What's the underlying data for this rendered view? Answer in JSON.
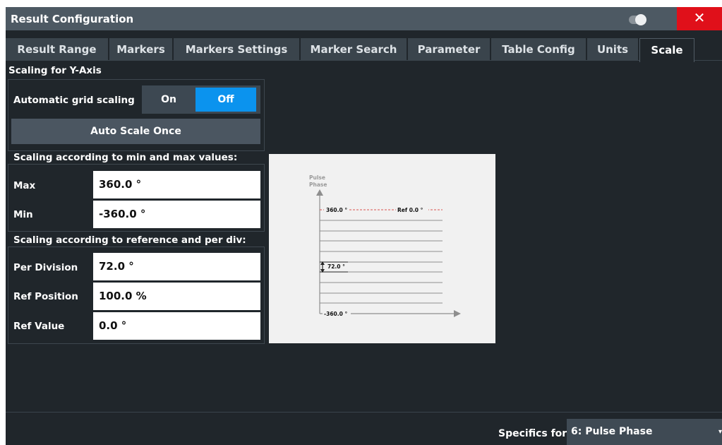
{
  "window": {
    "title": "Result Configuration"
  },
  "tabs": [
    {
      "label": "Result Range"
    },
    {
      "label": "Markers"
    },
    {
      "label": "Markers Settings"
    },
    {
      "label": "Marker Search"
    },
    {
      "label": "Parameter"
    },
    {
      "label": "Table Config"
    },
    {
      "label": "Units"
    },
    {
      "label": "Scale",
      "active": true
    }
  ],
  "scaling_y": {
    "heading": "Scaling for Y-Axis",
    "auto_grid_label": "Automatic grid scaling",
    "on_label": "On",
    "off_label": "Off",
    "selected": "Off",
    "auto_scale_once": "Auto Scale Once"
  },
  "minmax": {
    "heading": "Scaling according to min and max values:",
    "max_label": "Max",
    "max_value": "360.0 °",
    "min_label": "Min",
    "min_value": "-360.0 °"
  },
  "refdiv": {
    "heading": "Scaling according to reference and per div:",
    "per_division_label": "Per Division",
    "per_division_value": "72.0 °",
    "ref_position_label": "Ref Position",
    "ref_position_value": "100.0 %",
    "ref_value_label": "Ref Value",
    "ref_value_value": "0.0 °"
  },
  "diagram": {
    "y_axis_label_line1": "Pulse",
    "y_axis_label_line2": "Phase",
    "top_label": "360.0 °",
    "ref_label": "Ref 0.0 °",
    "div_label": "72.0 °",
    "bottom_label": "-360.0 °"
  },
  "footer": {
    "specifics_label": "Specifics for",
    "specifics_value": "6: Pulse Phase"
  },
  "colors": {
    "background": "#20262b",
    "titlebar": "#4d5963",
    "close": "#e0101a",
    "accent": "#0b93ee",
    "ref_line": "#d9534f"
  },
  "icons": {
    "close": "close-icon",
    "toggle": "toggle-icon",
    "dropdown": "chevron-down-icon"
  }
}
